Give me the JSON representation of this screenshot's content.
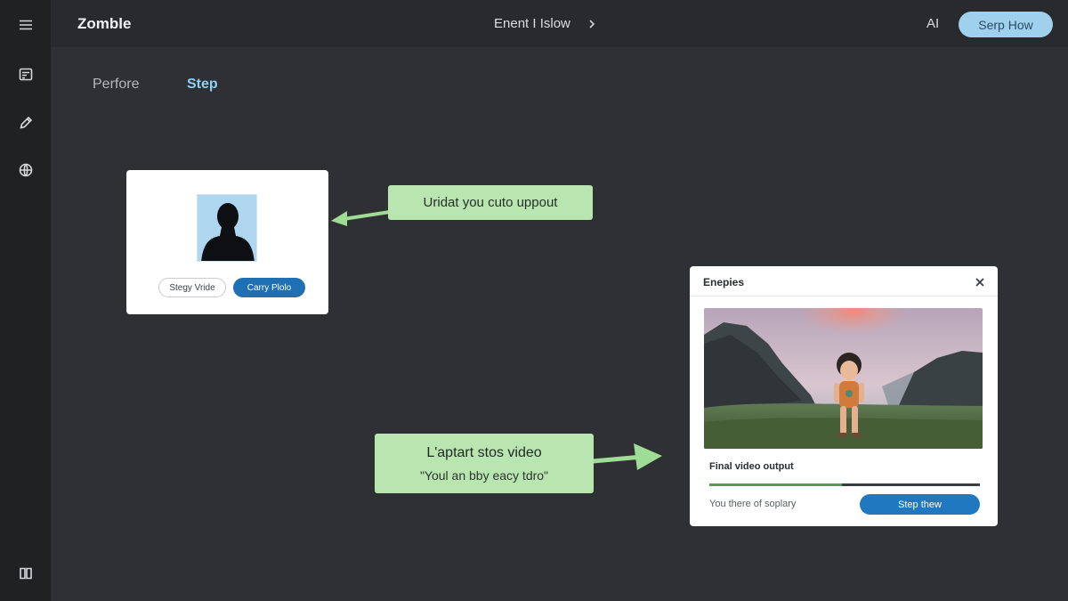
{
  "app": {
    "name": "Zomble"
  },
  "header": {
    "breadcrumb": "Enent I Islow",
    "ai_label": "AI",
    "cta_label": "Serp How"
  },
  "tabs": [
    {
      "label": "Perfore",
      "active": false
    },
    {
      "label": "Step",
      "active": true
    }
  ],
  "upload_card": {
    "secondary_button": "Stegy Vride",
    "primary_button": "Carry Plolo"
  },
  "callouts": {
    "upload": "Uridat you cuto uppout",
    "convert_title": "L'aptart stos video",
    "convert_subtitle": "\"Youl an bby eacy tdro\""
  },
  "dialog": {
    "title": "Enepies",
    "output_label": "Final video output",
    "progress": 0.49,
    "status": "You there of soplary",
    "action_button": "Step thew"
  },
  "icons": {
    "sidebar": [
      "menu-icon",
      "document-icon",
      "edit-icon",
      "globe-icon",
      "book-icon"
    ],
    "header": [
      "chevron-right-icon"
    ],
    "dialog": [
      "close-icon"
    ]
  },
  "colors": {
    "background": "#2e3033",
    "sidebar": "#1f2123",
    "accent_blue": "#1f6fb4",
    "cta_light_blue": "#9fd0ec",
    "callout_green": "#b9e6b0",
    "progress_green": "#4f9d5c",
    "active_tab": "#8fd0f2"
  }
}
